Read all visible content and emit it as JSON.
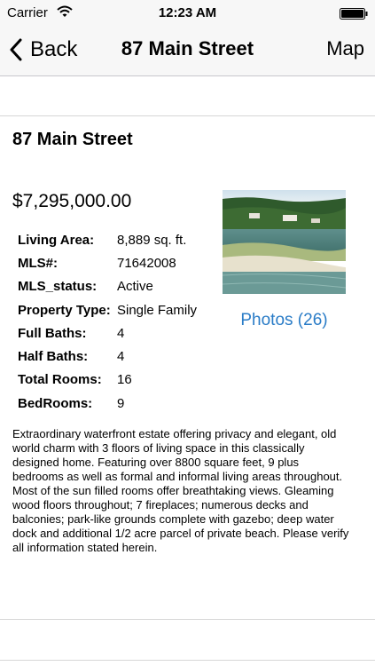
{
  "status_bar": {
    "carrier": "Carrier",
    "time": "12:23 AM"
  },
  "nav": {
    "back_label": "Back",
    "title": "87 Main Street",
    "map_label": "Map"
  },
  "listing": {
    "title": "87 Main Street",
    "price": "$7,295,000.00",
    "details": [
      {
        "label": "Living Area:",
        "value": "8,889 sq. ft."
      },
      {
        "label": "MLS#:",
        "value": "71642008"
      },
      {
        "label": "MLS_status:",
        "value": "Active"
      },
      {
        "label": "Property Type:",
        "value": "Single Family"
      },
      {
        "label": "Full Baths:",
        "value": "4"
      },
      {
        "label": "Half Baths:",
        "value": "4"
      },
      {
        "label": "Total Rooms:",
        "value": "16"
      },
      {
        "label": "BedRooms:",
        "value": "9"
      }
    ],
    "photos_link": "Photos (26)",
    "description": "Extraordinary waterfront estate offering privacy and elegant, old world charm with 3 floors of living space in this classically designed home. Featuring over 8800 square feet, 9 plus bedrooms as well as formal and informal living areas throughout. Most of the sun filled rooms offer breathtaking views. Gleaming wood floors throughout; 7 fireplaces; numerous decks and balconies; park-like grounds complete with gazebo; deep water dock and additional 1/2 acre parcel of private beach. Please verify all information stated herein."
  },
  "colors": {
    "link": "#2a7cc7",
    "bar_background": "#f7f7f7",
    "separator": "#d6d6d6"
  },
  "icons": [
    "wifi-icon",
    "battery-icon",
    "back-chevron-icon"
  ]
}
